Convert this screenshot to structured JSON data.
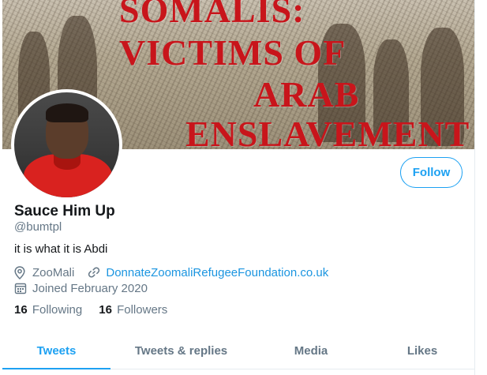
{
  "banner": {
    "lines": [
      "SOMALIS:",
      "VICTIMS OF",
      "ARAB",
      "ENSLAVEMENT"
    ]
  },
  "profile": {
    "display_name": "Sauce Him Up",
    "handle": "@bumtpl",
    "bio": "it is what it is Abdi",
    "location": "ZooMali",
    "website": "DonnateZoomaliRefugeeFoundation.co.uk",
    "joined": "Joined February 2020"
  },
  "actions": {
    "follow_label": "Follow"
  },
  "stats": {
    "following_count": "16",
    "following_label": "Following",
    "followers_count": "16",
    "followers_label": "Followers"
  },
  "tabs": [
    {
      "label": "Tweets",
      "active": true
    },
    {
      "label": "Tweets & replies",
      "active": false
    },
    {
      "label": "Media",
      "active": false
    },
    {
      "label": "Likes",
      "active": false
    }
  ],
  "colors": {
    "accent": "#1da1f2",
    "link": "#1b95e0",
    "banner_text": "#c8151b",
    "muted": "#657786"
  },
  "icons": {
    "location": "location-pin-icon",
    "website": "link-icon",
    "joined": "calendar-icon"
  }
}
